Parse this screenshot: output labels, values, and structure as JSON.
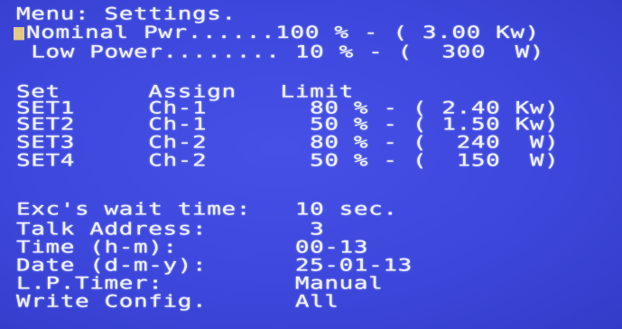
{
  "menu": {
    "title": "Menu: Settings."
  },
  "power": {
    "nominal": "Nominal Pwr......100 % - ( 3.00 Kw)",
    "low": " Low Power........ 10 % - (  300  W)"
  },
  "sets": {
    "header": "Set      Assign   Limit",
    "rows": [
      "SET1     Ch-1       80 % - ( 2.40 Kw)",
      "SET2     Ch-1       50 % - ( 1.50 Kw)",
      "SET3     Ch-2       80 % - (  240  W)",
      "SET4     Ch-2       50 % - (  150  W)"
    ]
  },
  "config": {
    "exc_wait": "Exc's wait time:   10 sec.",
    "talk_address": "Talk Address:       3",
    "time": "Time (h-m):        00-13",
    "date": "Date (d-m-y):      25-01-13",
    "lp_timer": "L.P.Timer:         Manual",
    "write_config": "Write Config.      All"
  },
  "colors": {
    "background": "#3d47dc",
    "text": "#eef0ff",
    "cursor": "#e2c98a"
  }
}
